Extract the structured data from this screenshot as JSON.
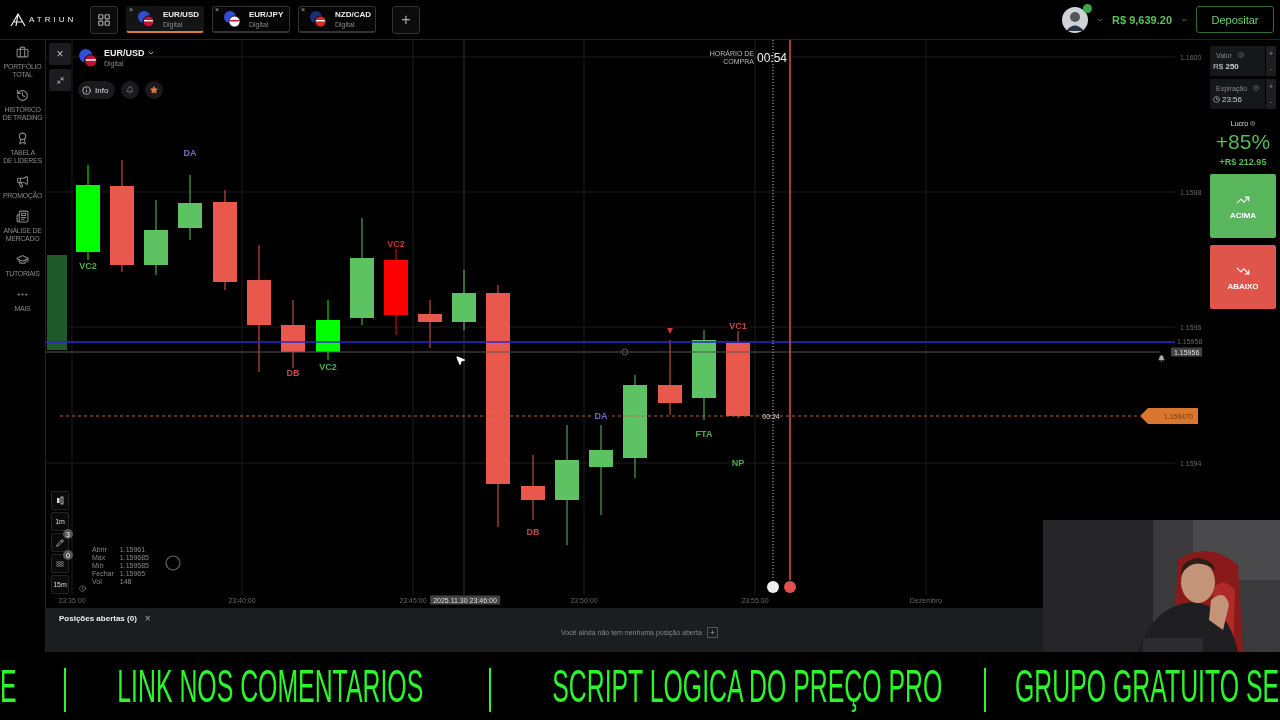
{
  "top_bar": {
    "logo": "ATRIUN",
    "add": "+",
    "balance": "R$ 9,639.20",
    "deposit": "Depositar",
    "tabs": [
      {
        "pair": "EUR/USD",
        "type": "Digital",
        "close": "×",
        "selected": true
      },
      {
        "pair": "EUR/JPY",
        "type": "Digital",
        "close": "×",
        "selected": false
      },
      {
        "pair": "NZD/CAD",
        "type": "Digital",
        "close": "×",
        "selected": false
      }
    ]
  },
  "sidebar": {
    "items": [
      {
        "kind": "portfolio",
        "label": "PORTFÓLIO\nTOTAL"
      },
      {
        "kind": "history",
        "label": "HISTÓRICO\nDE TRADING"
      },
      {
        "kind": "leaders",
        "label": "TABELA\nDE LÍDERES"
      },
      {
        "kind": "promo",
        "label": "PROMOÇÃO"
      },
      {
        "kind": "analysis",
        "label": "ANÁLISE DE\nMERCADO"
      },
      {
        "kind": "tutorials",
        "label": "TUTORIAIS"
      },
      {
        "kind": "more",
        "label": "MAIS"
      }
    ]
  },
  "chart": {
    "asset": "EUR/USD",
    "type": "Digital",
    "info": "Info",
    "close": "×",
    "price_ticks": [
      "1.1600",
      "1.1598",
      "1.1596",
      "1.1594"
    ],
    "level_line": "1.15958",
    "current_price": "1.15956",
    "entry_price": "1.159470",
    "time_ticks": [
      "23:35:00",
      "23:40:00",
      "23:45:00",
      "23:50:00",
      "23:55:00",
      "Dezembro"
    ],
    "crosshair_time": "2025.11.30 23:46:00",
    "purchase_label": "HORÁRIO DE\nCOMPRA",
    "purchase_timer": "00:54",
    "candle_timer": "00:24",
    "annotations": [
      {
        "text": "DA",
        "color": "#7b68c8"
      },
      {
        "text": "VC2",
        "color": "#4caf50"
      },
      {
        "text": "VC2",
        "color": "#d03030"
      },
      {
        "text": "DB",
        "color": "#c04848"
      },
      {
        "text": "VC2",
        "color": "#4caf50"
      },
      {
        "text": "DB",
        "color": "#c04848"
      },
      {
        "text": "DA",
        "color": "#7b68c8"
      },
      {
        "text": "FTA",
        "color": "#4caf50"
      },
      {
        "text": "NP",
        "color": "#4caf50"
      },
      {
        "text": "VC1",
        "color": "#c04848"
      }
    ],
    "tools": [
      {
        "kind": "candles"
      },
      {
        "kind": "timeframe",
        "label": "1m"
      },
      {
        "kind": "draw",
        "badge": "3"
      },
      {
        "kind": "indicators",
        "badge": "0"
      },
      {
        "kind": "timeframe",
        "label": "15m"
      }
    ],
    "legend": [
      {
        "label": "Abrir",
        "value": "1.15961"
      },
      {
        "label": "Máx",
        "value": "1.159685"
      },
      {
        "label": "Mín",
        "value": "1.159585"
      },
      {
        "label": "Fechar",
        "value": "1.15965"
      },
      {
        "label": "Vol",
        "value": "148"
      }
    ]
  },
  "trade_panel": {
    "amount_label": "Valor",
    "amount": "R$ **250**",
    "expiration_label": "Expiração",
    "expiration": "23:56",
    "plus": "+",
    "minus": "-",
    "profit_label": "Lucro",
    "profit_percent": "+85%",
    "profit_amount": "+R$ 212.95",
    "buttons": [
      {
        "kind": "up",
        "label": "ACIMA"
      },
      {
        "kind": "down",
        "label": "ABAIXO"
      }
    ]
  },
  "positions": {
    "title": "Posições abertas (0)",
    "close": "×",
    "empty": "Você ainda não tem nenhuma posição aberta",
    "add": "+"
  },
  "banner": {
    "items": [
      "E",
      "|",
      "LINK NOS COMENTARIOS",
      "|",
      "SCRIPT LOGICA DO PREÇO PRO",
      "|",
      "GRUPO GRATUITO SE"
    ]
  }
}
